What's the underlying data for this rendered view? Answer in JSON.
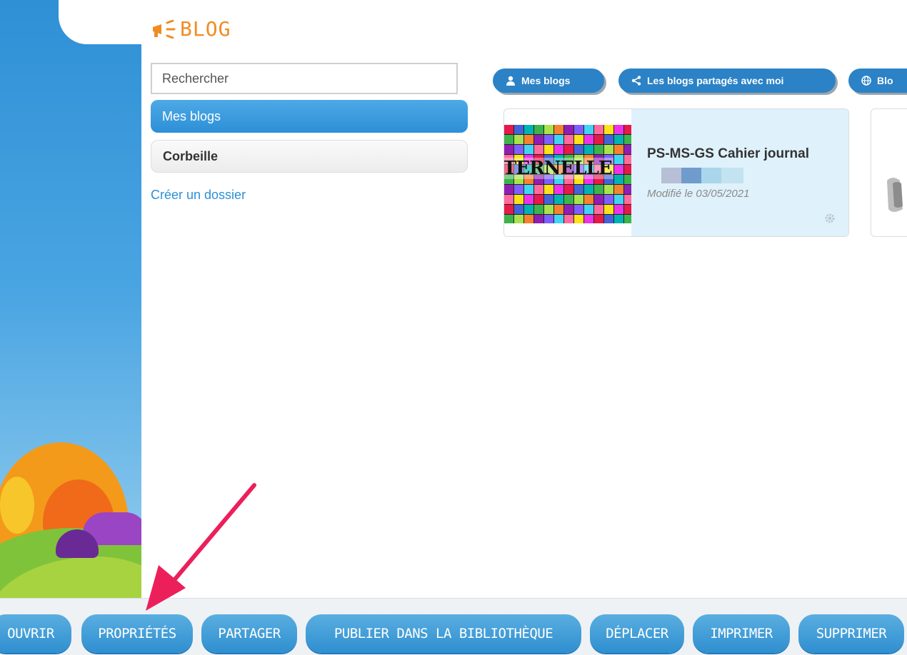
{
  "header": {
    "app_title": "BLOG"
  },
  "sidebar": {
    "search_placeholder": "Rechercher",
    "folders": [
      {
        "label": "Mes blogs",
        "active": true
      },
      {
        "label": "Corbeille",
        "active": false
      }
    ],
    "create_folder_label": "Créer un dossier"
  },
  "filters": [
    {
      "label": "Mes blogs",
      "icon": "user-icon"
    },
    {
      "label": "Les blogs partagés avec moi",
      "icon": "share-icon"
    },
    {
      "label": "Blo",
      "icon": "globe-icon"
    }
  ],
  "blogs": [
    {
      "title": "PS-MS-GS Cahier journal",
      "thumbnail_text": "TERNELLE",
      "modified": "Modifié le 03/05/2021",
      "icon": "gear-icon"
    }
  ],
  "actions": [
    {
      "label": "OUVRIR"
    },
    {
      "label": "PROPRIÉTÉS"
    },
    {
      "label": "PARTAGER"
    },
    {
      "label": "PUBLIER DANS LA BIBLIOTHÈQUE"
    },
    {
      "label": "DÉPLACER"
    },
    {
      "label": "IMPRIMER"
    },
    {
      "label": "SUPPRIMER"
    }
  ],
  "colors": {
    "accent": "#2b82c6",
    "title_orange": "#f08c23",
    "card_bg": "#dff1fb",
    "annotation_arrow": "#ec1f5b"
  }
}
